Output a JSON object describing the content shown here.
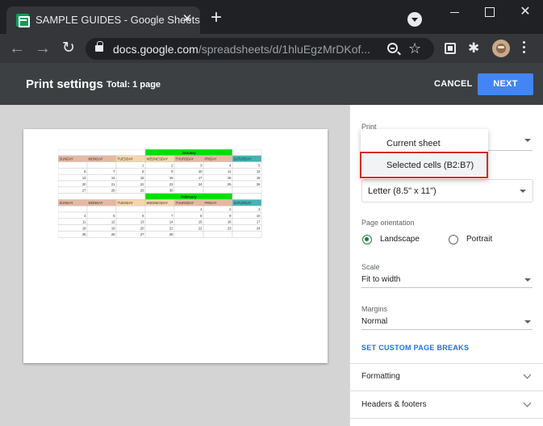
{
  "browser": {
    "tab_title": "SAMPLE GUIDES - Google Sheets",
    "tab_close": "✕",
    "new_tab": "+",
    "url_domain": "docs.google.com",
    "url_path": "/spreadsheets/d/1hluEgzMrDKof...",
    "window_close": "✕"
  },
  "header": {
    "title": "Print settings",
    "total": "Total: 1 page",
    "cancel": "CANCEL",
    "next": "NEXT"
  },
  "settings": {
    "print_label": "Print",
    "print_options": [
      "Current sheet",
      "Selected cells (B2:B7)"
    ],
    "paper_size": "Letter (8.5\" x 11\")",
    "orientation_label": "Page orientation",
    "orientation_options": [
      "Landscape",
      "Portrait"
    ],
    "orientation_selected": "Landscape",
    "scale_label": "Scale",
    "scale_value": "Fit to width",
    "margins_label": "Margins",
    "margins_value": "Normal",
    "custom_breaks": "SET CUSTOM PAGE BREAKS",
    "sections": [
      "Formatting",
      "Headers & footers"
    ]
  },
  "colors": {
    "accent": "#4285f4",
    "highlight": "#d62828",
    "month_header": "#00e000",
    "radio_selected": "#188038"
  },
  "preview": {
    "days": [
      "SUNDAY",
      "MONDAY",
      "TUESDAY",
      "WEDNESDAY",
      "THURSDAY",
      "FRIDAY",
      "SATURDAY"
    ],
    "day_colors": [
      "#e6b8a2",
      "#e6b8a2",
      "#f6d6a8",
      "#f6d6a8",
      "#e6b8a2",
      "#e6b8a2",
      "#45b3b3"
    ],
    "months": [
      {
        "name": "January",
        "weeks": [
          [
            "",
            "",
            "1",
            "2",
            "3",
            "4",
            "5"
          ],
          [
            "6",
            "7",
            "8",
            "9",
            "10",
            "11",
            "12"
          ],
          [
            "13",
            "14",
            "15",
            "16",
            "17",
            "18",
            "19"
          ],
          [
            "20",
            "21",
            "22",
            "23",
            "24",
            "25",
            "26"
          ],
          [
            "27",
            "28",
            "29",
            "30",
            "",
            "",
            ""
          ]
        ]
      },
      {
        "name": "February",
        "weeks": [
          [
            "",
            "",
            "",
            "",
            "1",
            "2",
            "3"
          ],
          [
            "4",
            "5",
            "6",
            "7",
            "8",
            "9",
            "10"
          ],
          [
            "11",
            "12",
            "13",
            "14",
            "15",
            "16",
            "17"
          ],
          [
            "18",
            "19",
            "20",
            "21",
            "22",
            "23",
            "24"
          ],
          [
            "25",
            "26",
            "27",
            "28",
            "",
            "",
            ""
          ]
        ]
      }
    ]
  }
}
